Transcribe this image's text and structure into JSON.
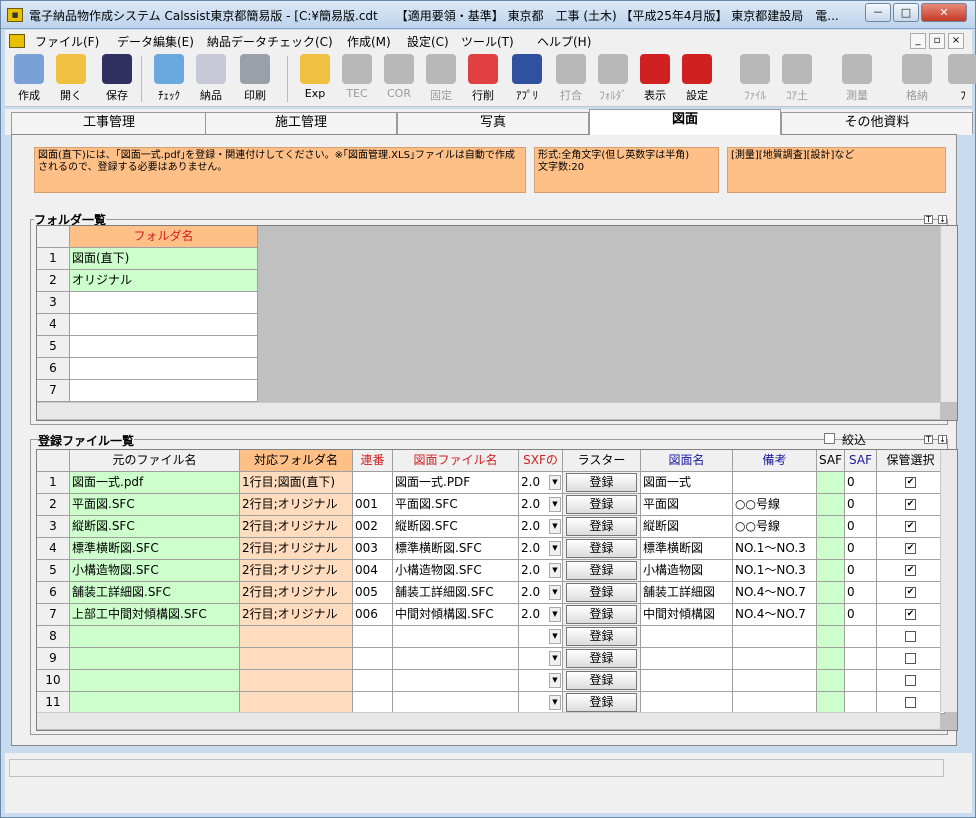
{
  "window": {
    "title": "電子納品物作成システム Calssist東京都簡易版 - [C:¥簡易版.cdt　　【適用要領・基準】 東京都　工事 (土木) 【平成25年4月版】 東京都建設局　電...",
    "min": "－",
    "max": "□",
    "close": "✕"
  },
  "menu": {
    "items": [
      "ファイル(F)",
      "データ編集(E)",
      "納品データチェック(C)",
      "作成(M)",
      "設定(C)",
      "ツール(T)",
      "ヘルプ(H)"
    ],
    "mdi": [
      "_",
      "▫",
      "×"
    ]
  },
  "toolbar": {
    "buttons": [
      {
        "label": "作成",
        "icon": "pen-write-icon",
        "color": "#7aa0d8",
        "disabled": false
      },
      {
        "label": "開く",
        "icon": "folder-open-icon",
        "color": "#f0c040",
        "disabled": false
      },
      {
        "label": "保存",
        "icon": "floppy-save-icon",
        "color": "#303060",
        "disabled": false
      },
      {
        "label": "ﾁｪｯｸ",
        "icon": "magnify-check-icon",
        "color": "#6aa8e0",
        "disabled": false
      },
      {
        "label": "納品",
        "icon": "cd-disc-icon",
        "color": "#c8c8d8",
        "disabled": false
      },
      {
        "label": "印刷",
        "icon": "printer-icon",
        "color": "#9aa0aa",
        "disabled": false
      },
      {
        "label": "Exp",
        "icon": "export-icon",
        "color": "#f0c040",
        "disabled": false
      },
      {
        "label": "TEC",
        "icon": "tec-icon",
        "color": "#b8b8b8",
        "disabled": true
      },
      {
        "label": "COR",
        "icon": "cor-icon",
        "color": "#b8b8b8",
        "disabled": true
      },
      {
        "label": "固定",
        "icon": "pin-icon",
        "color": "#b8b8b8",
        "disabled": true
      },
      {
        "label": "行削",
        "icon": "delete-row-icon",
        "color": "#e04040",
        "disabled": false
      },
      {
        "label": "ｱﾌﾟﾘ",
        "icon": "application-icon",
        "color": "#3050a0",
        "disabled": false
      },
      {
        "label": "打合",
        "icon": "meeting-icon",
        "color": "#b8b8b8",
        "disabled": true
      },
      {
        "label": "ﾌｫﾙﾀﾞ",
        "icon": "folder-icon",
        "color": "#b8b8b8",
        "disabled": true
      },
      {
        "label": "表示",
        "icon": "sxf-view-icon",
        "color": "#d02020",
        "disabled": false
      },
      {
        "label": "設定",
        "icon": "cad-settings-icon",
        "color": "#d02020",
        "disabled": false
      },
      {
        "label": "ﾌｧｲﾙ",
        "icon": "file-icon",
        "color": "#b8b8b8",
        "disabled": true
      },
      {
        "label": "ｺｱ土",
        "icon": "core-soil-icon",
        "color": "#b8b8b8",
        "disabled": true
      },
      {
        "label": "測量",
        "icon": "survey-icon",
        "color": "#b8b8b8",
        "disabled": true
      },
      {
        "label": "格納",
        "icon": "storage-icon",
        "color": "#b8b8b8",
        "disabled": true
      },
      {
        "label": "ﾌ",
        "icon": "more-icon",
        "color": "#b8b8b8",
        "disabled": false
      }
    ]
  },
  "tabs": [
    "工事管理",
    "施工管理",
    "写真",
    "図面",
    "その他資料"
  ],
  "active_tab": "図面",
  "hints": [
    "図面(直下)には、｢図面一式.pdf｣を登録・関連付けしてください。※｢図面管理.XLS｣ファイルは自動で作成されるので、登録する必要はありません。",
    "形式:全角文字(但し英数字は半角)\n文字数:20",
    "[測量][地質調査][設計]など"
  ],
  "folder_section": {
    "title": "フォルダ一覧",
    "column": "フォルダ名",
    "column_color": "#d02020",
    "rows": [
      "図面(直下)",
      "オリジナル",
      "",
      "",
      "",
      "",
      ""
    ],
    "top_icon": "T",
    "down_icon": "↓"
  },
  "file_section": {
    "title": "登録ファイル一覧",
    "filter_label": "絞込",
    "columns": [
      {
        "label": "元のファイル名",
        "color": "#000000"
      },
      {
        "label": "対応フォルダ名",
        "color": "#000000"
      },
      {
        "label": "連番",
        "color": "#d02020"
      },
      {
        "label": "図面ファイル名",
        "color": "#d02020"
      },
      {
        "label": "SXFの",
        "color": "#d02020"
      },
      {
        "label": "ラスター",
        "color": "#000000"
      },
      {
        "label": "図面名",
        "color": "#1a1aa0"
      },
      {
        "label": "備考",
        "color": "#1a1aa0"
      },
      {
        "label": "SAF",
        "color": "#000000"
      },
      {
        "label": "SAF",
        "color": "#1a1aa0"
      },
      {
        "label": "保管選択",
        "color": "#000000"
      }
    ],
    "register_label": "登録",
    "rows": [
      {
        "orig": "図面一式.pdf",
        "folder": "1行目;図面(直下)",
        "num": "",
        "file": "図面一式.PDF",
        "sxf": "2.0",
        "name": "図面一式",
        "note": "",
        "saf2": "0",
        "keep": true
      },
      {
        "orig": "平面図.SFC",
        "folder": "2行目;オリジナル",
        "num": "001",
        "file": "平面図.SFC",
        "sxf": "2.0",
        "name": "平面図",
        "note": "○○号線",
        "saf2": "0",
        "keep": true
      },
      {
        "orig": "縦断図.SFC",
        "folder": "2行目;オリジナル",
        "num": "002",
        "file": "縦断図.SFC",
        "sxf": "2.0",
        "name": "縦断図",
        "note": "○○号線",
        "saf2": "0",
        "keep": true
      },
      {
        "orig": "標準横断図.SFC",
        "folder": "2行目;オリジナル",
        "num": "003",
        "file": "標準横断図.SFC",
        "sxf": "2.0",
        "name": "標準横断図",
        "note": "NO.1～NO.3",
        "saf2": "0",
        "keep": true
      },
      {
        "orig": "小構造物図.SFC",
        "folder": "2行目;オリジナル",
        "num": "004",
        "file": "小構造物図.SFC",
        "sxf": "2.0",
        "name": "小構造物図",
        "note": "NO.1～NO.3",
        "saf2": "0",
        "keep": true
      },
      {
        "orig": "舗装工詳細図.SFC",
        "folder": "2行目;オリジナル",
        "num": "005",
        "file": "舗装工詳細図.SFC",
        "sxf": "2.0",
        "name": "舗装工詳細図",
        "note": "NO.4～NO.7",
        "saf2": "0",
        "keep": true
      },
      {
        "orig": "上部工中間対傾構図.SFC",
        "folder": "2行目;オリジナル",
        "num": "006",
        "file": "中間対傾構図.SFC",
        "sxf": "2.0",
        "name": "中間対傾構図",
        "note": "NO.4～NO.7",
        "saf2": "0",
        "keep": true
      },
      {
        "orig": "",
        "folder": "",
        "num": "",
        "file": "",
        "sxf": "",
        "name": "",
        "note": "",
        "saf2": "",
        "keep": false
      },
      {
        "orig": "",
        "folder": "",
        "num": "",
        "file": "",
        "sxf": "",
        "name": "",
        "note": "",
        "saf2": "",
        "keep": false
      },
      {
        "orig": "",
        "folder": "",
        "num": "",
        "file": "",
        "sxf": "",
        "name": "",
        "note": "",
        "saf2": "",
        "keep": false
      },
      {
        "orig": "",
        "folder": "",
        "num": "",
        "file": "",
        "sxf": "",
        "name": "",
        "note": "",
        "saf2": "",
        "keep": false
      }
    ]
  },
  "colors": {
    "green_cell": "#ccffcc",
    "orange_cell": "#ffdcbe",
    "orange_header": "#ffc088"
  }
}
